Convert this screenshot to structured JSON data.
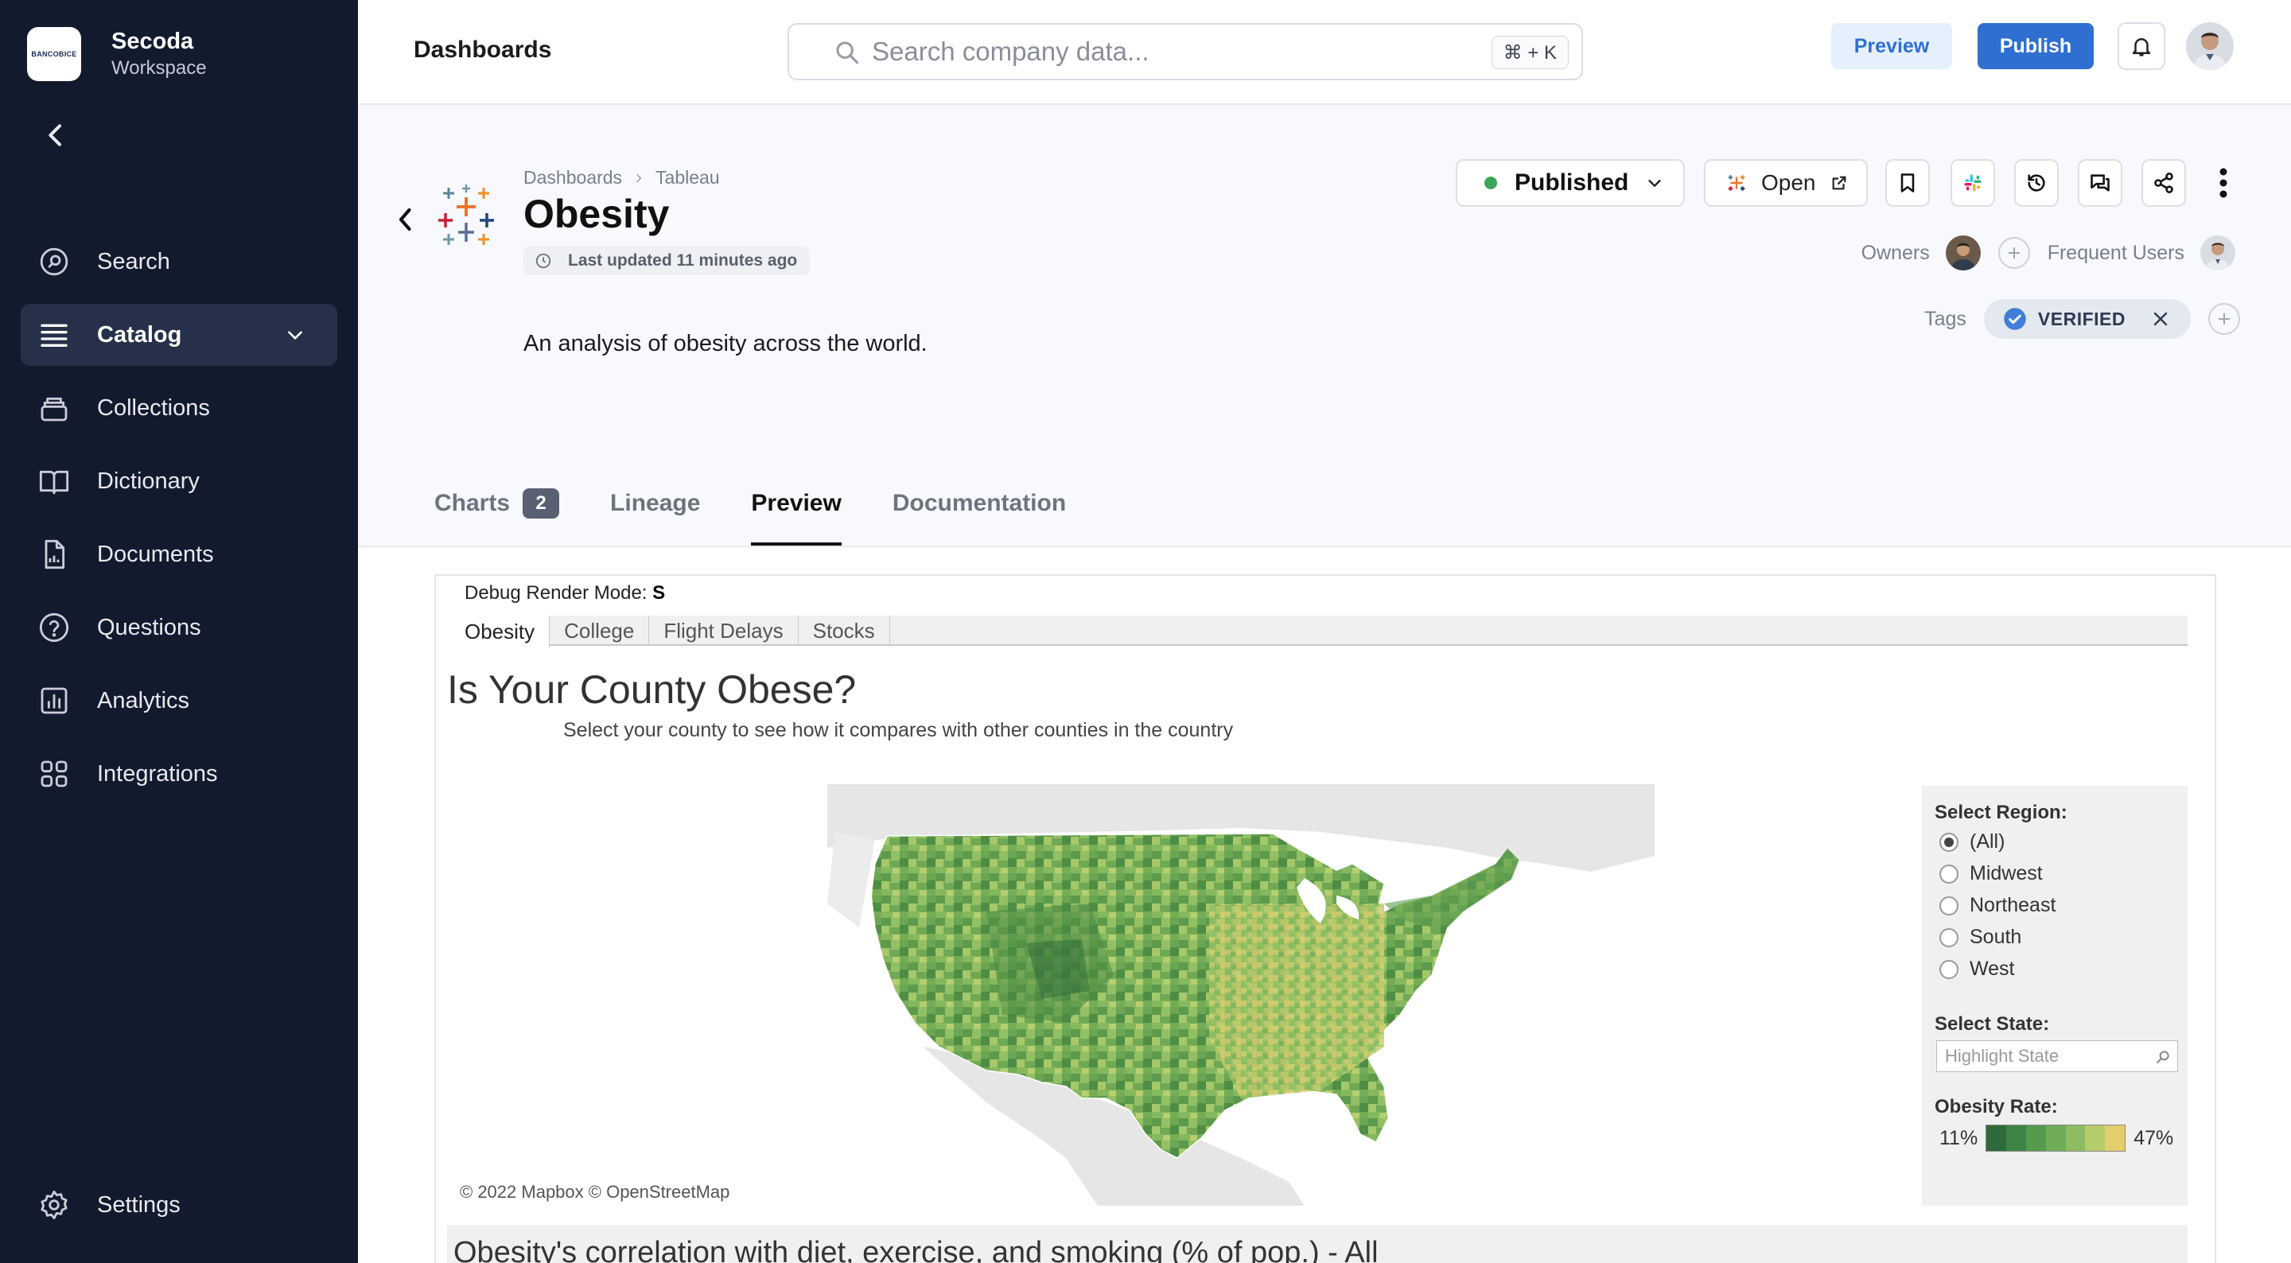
{
  "workspace": {
    "logo_text": "BANCOBICE",
    "name": "Secoda",
    "subtitle": "Workspace"
  },
  "sidebar": {
    "items": [
      {
        "label": "Search",
        "icon": "search-icon"
      },
      {
        "label": "Catalog",
        "icon": "catalog-icon",
        "active": true
      },
      {
        "label": "Collections",
        "icon": "collections-icon"
      },
      {
        "label": "Dictionary",
        "icon": "book-icon"
      },
      {
        "label": "Documents",
        "icon": "document-icon"
      },
      {
        "label": "Questions",
        "icon": "question-icon"
      },
      {
        "label": "Analytics",
        "icon": "analytics-icon"
      },
      {
        "label": "Integrations",
        "icon": "integrations-icon"
      }
    ],
    "settings_label": "Settings"
  },
  "topbar": {
    "title": "Dashboards",
    "search_placeholder": "Search company data...",
    "shortcut": "⌘ + K",
    "preview_label": "Preview",
    "publish_label": "Publish"
  },
  "resource": {
    "breadcrumb": [
      "Dashboards",
      "Tableau"
    ],
    "title": "Obesity",
    "last_updated": "Last updated 11 minutes ago",
    "description": "An analysis of obesity across the world.",
    "status": "Published",
    "open_label": "Open",
    "owners_label": "Owners",
    "frequent_users_label": "Frequent Users",
    "tags_label": "Tags",
    "tag": "VERIFIED"
  },
  "tabs": [
    {
      "label": "Charts",
      "badge": "2"
    },
    {
      "label": "Lineage"
    },
    {
      "label": "Preview",
      "active": true
    },
    {
      "label": "Documentation"
    }
  ],
  "preview": {
    "debug_label": "Debug Render Mode:",
    "debug_value": "S",
    "workbook_tabs": [
      "Obesity",
      "College",
      "Flight Delays",
      "Stocks"
    ],
    "title": "Is Your County Obese?",
    "subtitle": "Select your county to see how it compares with other counties in the country",
    "copyright": "© 2022 Mapbox  © OpenStreetMap",
    "region_label": "Select Region:",
    "regions": [
      "(All)",
      "Midwest",
      "Northeast",
      "South",
      "West"
    ],
    "selected_region": "(All)",
    "state_label": "Select State:",
    "state_placeholder": "Highlight State",
    "rate_label": "Obesity Rate:",
    "rate_min": "11%",
    "rate_max": "47%",
    "rate_colors": [
      "#2f6b3a",
      "#3f8447",
      "#569a50",
      "#6fac58",
      "#8dbd62",
      "#b4cc6c",
      "#e3cd6d"
    ],
    "section2_title": "Obesity's correlation with diet, exercise, and smoking (% of pop.) - All"
  },
  "colors": {
    "sidebar_bg": "#121a2e",
    "accent": "#2f6fd1",
    "published": "#3aa657"
  }
}
